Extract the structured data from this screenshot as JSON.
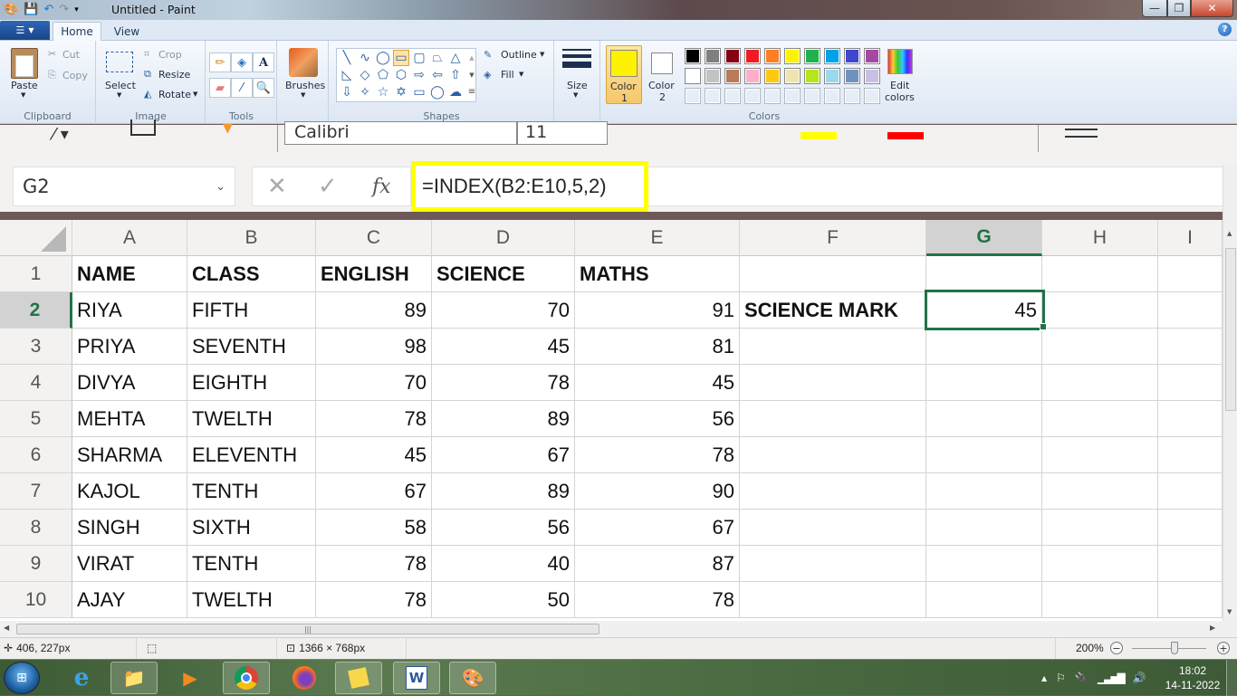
{
  "window": {
    "title": "Untitled - Paint",
    "controls": {
      "minimize": "—",
      "maximize": "❐",
      "close": "✕"
    }
  },
  "ribbon_tabs": [
    {
      "label": "Home",
      "active": true
    },
    {
      "label": "View",
      "active": false
    }
  ],
  "ribbon": {
    "clipboard": {
      "label": "Clipboard",
      "paste": "Paste",
      "cut": "Cut",
      "copy": "Copy"
    },
    "image": {
      "label": "Image",
      "select": "Select",
      "crop": "Crop",
      "resize": "Resize",
      "rotate": "Rotate"
    },
    "tools": {
      "label": "Tools",
      "items": [
        "pencil",
        "fill",
        "text",
        "eraser",
        "color-picker",
        "magnifier"
      ]
    },
    "brushes": {
      "label": "Brushes"
    },
    "shapes": {
      "label": "Shapes",
      "outline": "Outline",
      "fill": "Fill",
      "selected": "rectangle"
    },
    "size": {
      "label": "Size"
    },
    "colors": {
      "label": "Colors",
      "color1": {
        "label_line1": "Color",
        "label_line2": "1",
        "value": "#FFF200"
      },
      "color2": {
        "label_line1": "Color",
        "label_line2": "2",
        "value": "#FFFFFF"
      },
      "palette_row1": [
        "#000000",
        "#7F7F7F",
        "#880015",
        "#ED1C24",
        "#FF7F27",
        "#FFF200",
        "#22B14C",
        "#00A2E8",
        "#3F48CC",
        "#A349A4"
      ],
      "palette_row2": [
        "#FFFFFF",
        "#C3C3C3",
        "#B97A57",
        "#FFAEC9",
        "#FFC90E",
        "#EFE4B0",
        "#B5E61D",
        "#99D9EA",
        "#7092BE",
        "#C8BFE7"
      ],
      "edit_colors_line1": "Edit",
      "edit_colors_line2": "colors"
    }
  },
  "excel_capture": {
    "font_name": "Calibri",
    "font_size": "11",
    "name_box": "G2",
    "formula": "=INDEX(B2:E10,5,2)",
    "highlight_color": "#FFFF00",
    "column_headers": [
      "A",
      "B",
      "C",
      "D",
      "E",
      "F",
      "G",
      "H",
      "I"
    ],
    "selected_column": "G",
    "row_headers": [
      "1",
      "2",
      "3",
      "4",
      "5",
      "6",
      "7",
      "8",
      "9",
      "10"
    ],
    "selected_row": "2",
    "header_row": [
      "NAME",
      "CLASS",
      "ENGLISH",
      "SCIENCE",
      "MATHS"
    ],
    "rows": [
      [
        "RIYA",
        "FIFTH",
        "89",
        "70",
        "91"
      ],
      [
        "PRIYA",
        "SEVENTH",
        "98",
        "45",
        "81"
      ],
      [
        "DIVYA",
        "EIGHTH",
        "70",
        "78",
        "45"
      ],
      [
        "MEHTA",
        "TWELTH",
        "78",
        "89",
        "56"
      ],
      [
        "SHARMA",
        "ELEVENTH",
        "45",
        "67",
        "78"
      ],
      [
        "KAJOL",
        "TENTH",
        "67",
        "89",
        "90"
      ],
      [
        "SINGH",
        "SIXTH",
        "58",
        "56",
        "67"
      ],
      [
        "VIRAT",
        "TENTH",
        "78",
        "40",
        "87"
      ],
      [
        "AJAY",
        "TWELTH",
        "78",
        "50",
        "78"
      ]
    ],
    "f2_label": "SCIENCE MARK",
    "g2_value": "45"
  },
  "statusbar": {
    "cursor_position": "406, 227px",
    "image_size": "1366 × 768px",
    "zoom_level": "200%",
    "zoom_percent": 200
  },
  "taskbar": {
    "apps": [
      "Internet Explorer",
      "File Explorer",
      "Windows Media Player",
      "Google Chrome",
      "Firefox",
      "Sticky Notes",
      "Microsoft Word",
      "Paint"
    ],
    "clock_time": "18:02",
    "clock_date": "14-11-2022"
  }
}
